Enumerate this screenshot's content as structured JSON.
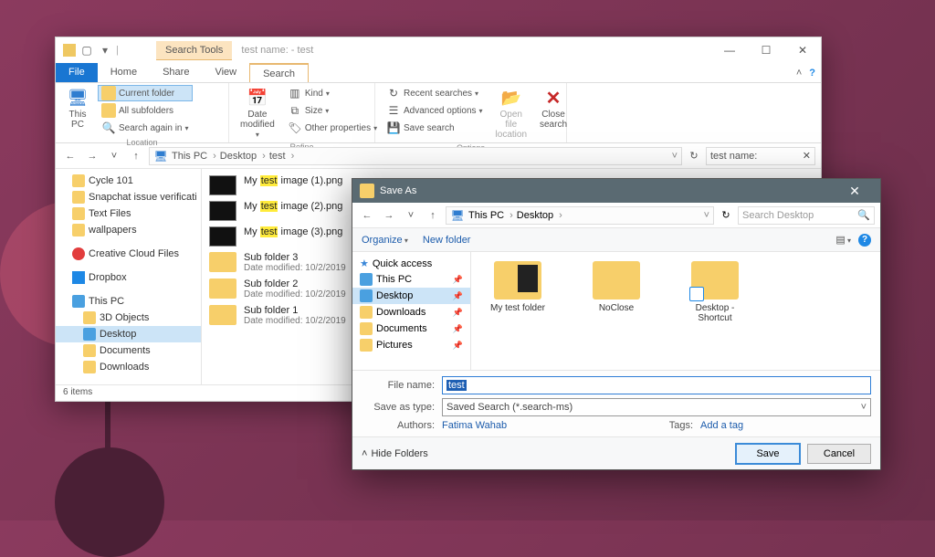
{
  "explorer": {
    "search_tools_label": "Search Tools",
    "window_title": "test name: - test",
    "tabs": {
      "file": "File",
      "home": "Home",
      "share": "Share",
      "view": "View",
      "search": "Search"
    },
    "ribbon": {
      "this_pc": "This\nPC",
      "current_folder": "Current folder",
      "all_subfolders": "All subfolders",
      "search_again": "Search again in",
      "group_location": "Location",
      "date_modified": "Date\nmodified",
      "kind": "Kind",
      "size": "Size",
      "other_properties": "Other properties",
      "group_refine": "Refine",
      "recent_searches": "Recent searches",
      "advanced_options": "Advanced options",
      "save_search": "Save search",
      "open_file_location": "Open file\nlocation",
      "close_search": "Close\nsearch",
      "group_options": "Options"
    },
    "breadcrumb": [
      "This PC",
      "Desktop",
      "test"
    ],
    "search_text": "test name:",
    "nav": [
      {
        "label": "Cycle 101",
        "icon": "folder-y"
      },
      {
        "label": "Snapchat issue verificati",
        "icon": "folder-y"
      },
      {
        "label": "Text Files",
        "icon": "folder-y"
      },
      {
        "label": "wallpapers",
        "icon": "folder-y"
      },
      {
        "label": "Creative Cloud Files",
        "icon": "cc-ico",
        "spaced": true
      },
      {
        "label": "Dropbox",
        "icon": "db-ico",
        "spaced": true
      },
      {
        "label": "This PC",
        "icon": "pc-ico",
        "spaced": true
      },
      {
        "label": "3D Objects",
        "icon": "folder-y",
        "indent": true
      },
      {
        "label": "Desktop",
        "icon": "pc-ico",
        "indent": true,
        "selected": true
      },
      {
        "label": "Documents",
        "icon": "folder-y",
        "indent": true
      },
      {
        "label": "Downloads",
        "icon": "folder-y",
        "indent": true
      }
    ],
    "files": [
      {
        "name_pre": "My ",
        "name_hl": "test",
        "name_post": " image (1).png",
        "thumb": "img"
      },
      {
        "name_pre": "My ",
        "name_hl": "test",
        "name_post": " image (2).png",
        "thumb": "img"
      },
      {
        "name_pre": "My ",
        "name_hl": "test",
        "name_post": " image (3).png",
        "thumb": "img"
      },
      {
        "name_pre": "Sub folder 3",
        "thumb": "folder",
        "meta": "Date modified: 10/2/2019"
      },
      {
        "name_pre": "Sub folder 2",
        "thumb": "folder",
        "meta": "Date modified: 10/2/2019"
      },
      {
        "name_pre": "Sub folder 1",
        "thumb": "folder",
        "meta": "Date modified: 10/2/2019"
      }
    ],
    "status": "6 items"
  },
  "saveas": {
    "title": "Save As",
    "breadcrumb": [
      "This PC",
      "Desktop"
    ],
    "search_placeholder": "Search Desktop",
    "organize": "Organize",
    "new_folder": "New folder",
    "nav": [
      {
        "label": "Quick access",
        "icon": "star"
      },
      {
        "label": "This PC",
        "icon": "pc-ico",
        "pin": true
      },
      {
        "label": "Desktop",
        "icon": "pc-ico",
        "pin": true,
        "selected": true
      },
      {
        "label": "Downloads",
        "icon": "folder-y",
        "pin": true
      },
      {
        "label": "Documents",
        "icon": "folder-y",
        "pin": true
      },
      {
        "label": "Pictures",
        "icon": "folder-y",
        "pin": true
      }
    ],
    "items": [
      {
        "label": "My test folder",
        "kind": "dark"
      },
      {
        "label": "NoClose",
        "kind": "plain"
      },
      {
        "label": "Desktop - Shortcut",
        "kind": "shortcut"
      }
    ],
    "filename_label": "File name:",
    "filename_value": "test",
    "saveastype_label": "Save as type:",
    "saveastype_value": "Saved Search (*.search-ms)",
    "authors_label": "Authors:",
    "authors_value": "Fatima Wahab",
    "tags_label": "Tags:",
    "tags_value": "Add a tag",
    "hide_folders": "Hide Folders",
    "save": "Save",
    "cancel": "Cancel"
  }
}
